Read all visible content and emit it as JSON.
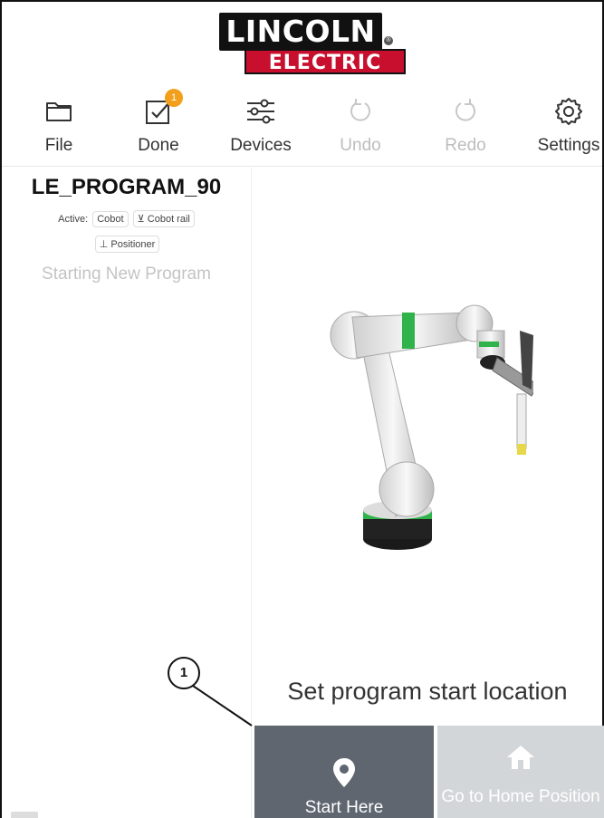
{
  "logo": {
    "line1": "LINCOLN",
    "line2": "ELECTRIC",
    "registered": "®"
  },
  "toolbar": {
    "items": [
      {
        "label": "File",
        "icon": "folder-icon",
        "enabled": true
      },
      {
        "label": "Done",
        "icon": "checkbox-done-icon",
        "enabled": true,
        "badge": "1"
      },
      {
        "label": "Devices",
        "icon": "sliders-icon",
        "enabled": true
      },
      {
        "label": "Undo",
        "icon": "undo-icon",
        "enabled": false
      },
      {
        "label": "Redo",
        "icon": "redo-icon",
        "enabled": false
      },
      {
        "label": "Settings",
        "icon": "gear-icon",
        "enabled": true
      }
    ]
  },
  "program": {
    "name": "LE_PROGRAM_90",
    "active_label": "Active:",
    "devices": [
      "Cobot",
      "Cobot rail",
      "Positioner"
    ],
    "status": "Starting New Program"
  },
  "main": {
    "prompt": "Set program start location",
    "start_button": "Start Here",
    "home_button": "Go to Home Position"
  },
  "callout": {
    "number": "1"
  },
  "colors": {
    "brand_red": "#c8102e",
    "badge_orange": "#f2a01c",
    "start_button_bg": "#5f6670",
    "home_button_bg": "#d3d6d9",
    "robot_accent_green": "#2fb34a"
  }
}
